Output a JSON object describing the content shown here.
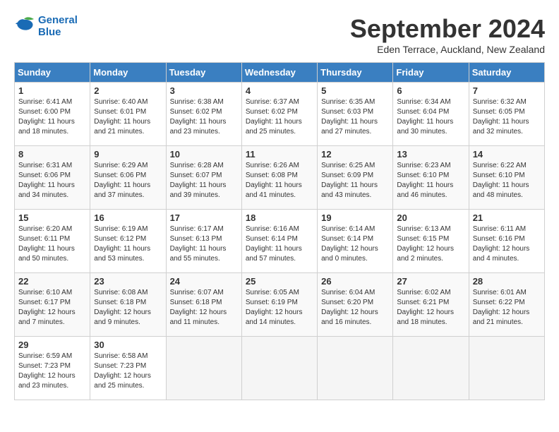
{
  "header": {
    "logo_line1": "General",
    "logo_line2": "Blue",
    "month_title": "September 2024",
    "location": "Eden Terrace, Auckland, New Zealand"
  },
  "days_of_week": [
    "Sunday",
    "Monday",
    "Tuesday",
    "Wednesday",
    "Thursday",
    "Friday",
    "Saturday"
  ],
  "weeks": [
    [
      {
        "day": "1",
        "sunrise": "6:41 AM",
        "sunset": "6:00 PM",
        "daylight": "11 hours and 18 minutes."
      },
      {
        "day": "2",
        "sunrise": "6:40 AM",
        "sunset": "6:01 PM",
        "daylight": "11 hours and 21 minutes."
      },
      {
        "day": "3",
        "sunrise": "6:38 AM",
        "sunset": "6:02 PM",
        "daylight": "11 hours and 23 minutes."
      },
      {
        "day": "4",
        "sunrise": "6:37 AM",
        "sunset": "6:02 PM",
        "daylight": "11 hours and 25 minutes."
      },
      {
        "day": "5",
        "sunrise": "6:35 AM",
        "sunset": "6:03 PM",
        "daylight": "11 hours and 27 minutes."
      },
      {
        "day": "6",
        "sunrise": "6:34 AM",
        "sunset": "6:04 PM",
        "daylight": "11 hours and 30 minutes."
      },
      {
        "day": "7",
        "sunrise": "6:32 AM",
        "sunset": "6:05 PM",
        "daylight": "11 hours and 32 minutes."
      }
    ],
    [
      {
        "day": "8",
        "sunrise": "6:31 AM",
        "sunset": "6:06 PM",
        "daylight": "11 hours and 34 minutes."
      },
      {
        "day": "9",
        "sunrise": "6:29 AM",
        "sunset": "6:06 PM",
        "daylight": "11 hours and 37 minutes."
      },
      {
        "day": "10",
        "sunrise": "6:28 AM",
        "sunset": "6:07 PM",
        "daylight": "11 hours and 39 minutes."
      },
      {
        "day": "11",
        "sunrise": "6:26 AM",
        "sunset": "6:08 PM",
        "daylight": "11 hours and 41 minutes."
      },
      {
        "day": "12",
        "sunrise": "6:25 AM",
        "sunset": "6:09 PM",
        "daylight": "11 hours and 43 minutes."
      },
      {
        "day": "13",
        "sunrise": "6:23 AM",
        "sunset": "6:10 PM",
        "daylight": "11 hours and 46 minutes."
      },
      {
        "day": "14",
        "sunrise": "6:22 AM",
        "sunset": "6:10 PM",
        "daylight": "11 hours and 48 minutes."
      }
    ],
    [
      {
        "day": "15",
        "sunrise": "6:20 AM",
        "sunset": "6:11 PM",
        "daylight": "11 hours and 50 minutes."
      },
      {
        "day": "16",
        "sunrise": "6:19 AM",
        "sunset": "6:12 PM",
        "daylight": "11 hours and 53 minutes."
      },
      {
        "day": "17",
        "sunrise": "6:17 AM",
        "sunset": "6:13 PM",
        "daylight": "11 hours and 55 minutes."
      },
      {
        "day": "18",
        "sunrise": "6:16 AM",
        "sunset": "6:14 PM",
        "daylight": "11 hours and 57 minutes."
      },
      {
        "day": "19",
        "sunrise": "6:14 AM",
        "sunset": "6:14 PM",
        "daylight": "12 hours and 0 minutes."
      },
      {
        "day": "20",
        "sunrise": "6:13 AM",
        "sunset": "6:15 PM",
        "daylight": "12 hours and 2 minutes."
      },
      {
        "day": "21",
        "sunrise": "6:11 AM",
        "sunset": "6:16 PM",
        "daylight": "12 hours and 4 minutes."
      }
    ],
    [
      {
        "day": "22",
        "sunrise": "6:10 AM",
        "sunset": "6:17 PM",
        "daylight": "12 hours and 7 minutes."
      },
      {
        "day": "23",
        "sunrise": "6:08 AM",
        "sunset": "6:18 PM",
        "daylight": "12 hours and 9 minutes."
      },
      {
        "day": "24",
        "sunrise": "6:07 AM",
        "sunset": "6:18 PM",
        "daylight": "12 hours and 11 minutes."
      },
      {
        "day": "25",
        "sunrise": "6:05 AM",
        "sunset": "6:19 PM",
        "daylight": "12 hours and 14 minutes."
      },
      {
        "day": "26",
        "sunrise": "6:04 AM",
        "sunset": "6:20 PM",
        "daylight": "12 hours and 16 minutes."
      },
      {
        "day": "27",
        "sunrise": "6:02 AM",
        "sunset": "6:21 PM",
        "daylight": "12 hours and 18 minutes."
      },
      {
        "day": "28",
        "sunrise": "6:01 AM",
        "sunset": "6:22 PM",
        "daylight": "12 hours and 21 minutes."
      }
    ],
    [
      {
        "day": "29",
        "sunrise": "6:59 AM",
        "sunset": "7:23 PM",
        "daylight": "12 hours and 23 minutes."
      },
      {
        "day": "30",
        "sunrise": "6:58 AM",
        "sunset": "7:23 PM",
        "daylight": "12 hours and 25 minutes."
      },
      null,
      null,
      null,
      null,
      null
    ]
  ],
  "labels": {
    "sunrise": "Sunrise: ",
    "sunset": "Sunset: ",
    "daylight": "Daylight: "
  }
}
